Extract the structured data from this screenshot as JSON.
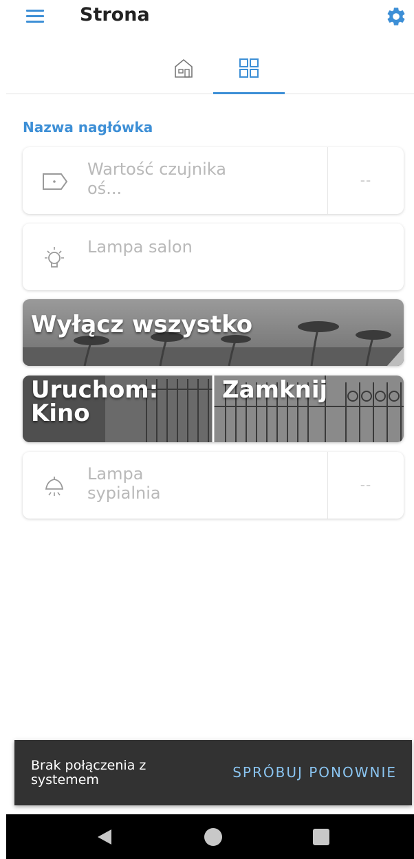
{
  "header": {
    "title": "Strona"
  },
  "section": {
    "title": "Nazwa nagłówka"
  },
  "cards": {
    "sensor": {
      "label": "Wartość czujnika oś...",
      "value": "--",
      "icon": "tag-icon"
    },
    "lamp_living": {
      "label": "Lampa salon",
      "icon": "bulb-icon"
    },
    "lamp_bedroom": {
      "label": "Lampa sypialnia",
      "value": "--",
      "icon": "ceiling-lamp-icon"
    }
  },
  "scenes": {
    "all_off": {
      "label": "Wyłącz wszystko"
    },
    "cinema": {
      "label": "Uruchom: Kino"
    },
    "close": {
      "label": "Zamknij"
    }
  },
  "snackbar": {
    "message": "Brak połączenia z systemem",
    "action": "SPRÓBUJ PONOWNIE"
  },
  "colors": {
    "accent": "#3d8fd6",
    "snackbar_bg": "#323232",
    "snackbar_action": "#8ac4f0"
  }
}
